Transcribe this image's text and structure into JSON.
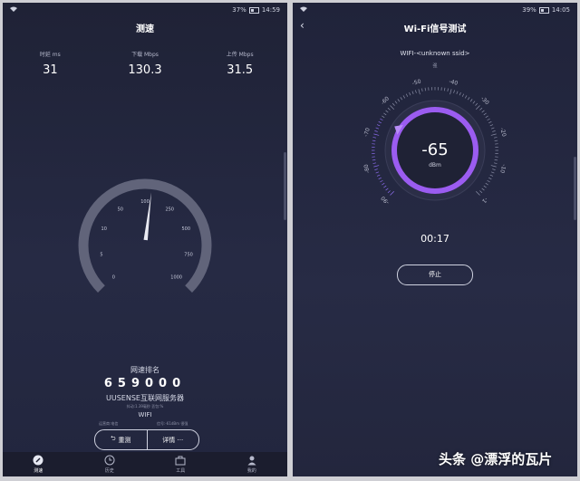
{
  "left": {
    "status": {
      "battery": "37%",
      "time": "14:59"
    },
    "title": "测速",
    "stats": [
      {
        "label": "时延 ms",
        "value": "31"
      },
      {
        "label": "下载 Mbps",
        "value": "130.3"
      },
      {
        "label": "上传 Mbps",
        "value": "31.5"
      }
    ],
    "gauge": {
      "ticks": [
        {
          "label": "0",
          "frac": 0.0
        },
        {
          "label": "5",
          "frac": 0.125
        },
        {
          "label": "10",
          "frac": 0.25
        },
        {
          "label": "50",
          "frac": 0.375
        },
        {
          "label": "100",
          "frac": 0.5
        },
        {
          "label": "250",
          "frac": 0.625
        },
        {
          "label": "500",
          "frac": 0.75
        },
        {
          "label": "750",
          "frac": 0.875
        },
        {
          "label": "1000",
          "frac": 1.0
        }
      ],
      "needle_value": 130.3
    },
    "rank_title": "网速排名",
    "rank": "659000",
    "server": "UUSENSE互联网服务器",
    "subinfo": "抖动:1.39毫秒      丢包:%",
    "wifi_label": "WIFI",
    "info_a": "运营商:电信",
    "info_b": "信号:-61dBm 很强",
    "retest_label": "重测",
    "details_label": "详情 ···",
    "tabs": [
      {
        "label": "测速",
        "icon": "speedometer-icon"
      },
      {
        "label": "历史",
        "icon": "clock-icon"
      },
      {
        "label": "工具",
        "icon": "toolbox-icon"
      },
      {
        "label": "我的",
        "icon": "user-icon"
      }
    ]
  },
  "right": {
    "status": {
      "battery": "39%",
      "time": "14:05"
    },
    "title": "Wi-Fi信号测试",
    "ssid": "WIFI-<unknown ssid>",
    "ssid_sub": "强",
    "dial": {
      "ticks": [
        {
          "label": "-90",
          "frac": 0.0
        },
        {
          "label": "-80",
          "frac": 0.111
        },
        {
          "label": "-70",
          "frac": 0.222
        },
        {
          "label": "-60",
          "frac": 0.333
        },
        {
          "label": "-50",
          "frac": 0.444
        },
        {
          "label": "-40",
          "frac": 0.556
        },
        {
          "label": "-30",
          "frac": 0.667
        },
        {
          "label": "-20",
          "frac": 0.778
        },
        {
          "label": "-10",
          "frac": 0.889
        },
        {
          "label": "-1",
          "frac": 1.0
        }
      ],
      "value": "-65",
      "unit": "dBm",
      "level_fraction": 0.28
    },
    "timer": "00:17",
    "stop_label": "停止"
  },
  "watermark": "头条 @漂浮的瓦片",
  "colors": {
    "accent_purple": "#9b5cf0",
    "bg_dark": "#22263e",
    "tick": "#8a8ea6"
  }
}
